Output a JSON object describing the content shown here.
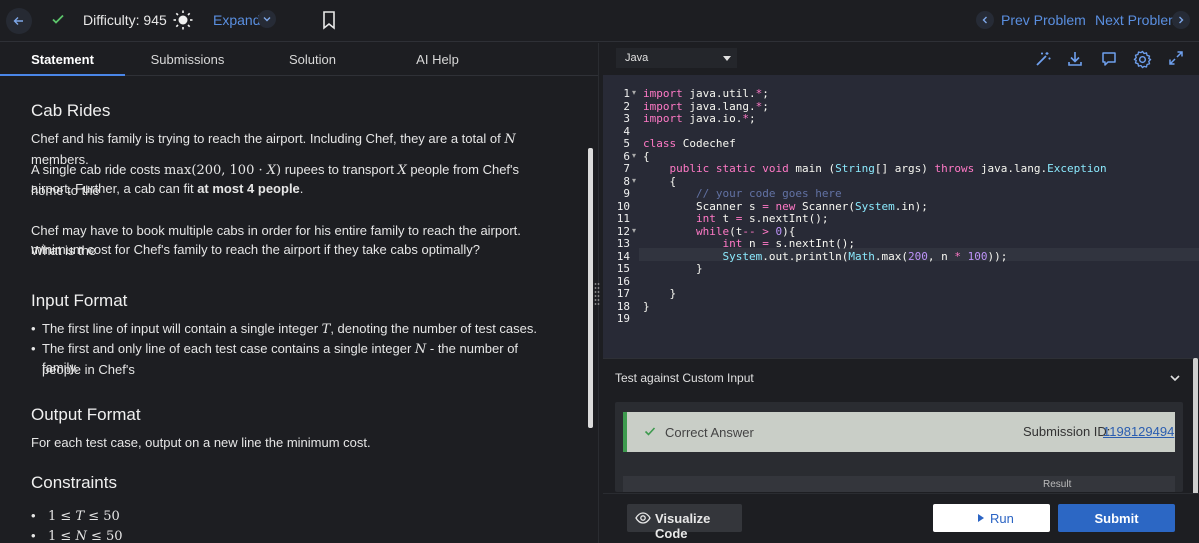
{
  "topbar": {
    "difficulty": "Difficulty: 945",
    "expand": "Expand",
    "prev": "Prev Problem",
    "next": "Next Problem"
  },
  "tabs": [
    "Statement",
    "Submissions",
    "Solution",
    "AI Help"
  ],
  "statement": {
    "title": "Cab Rides",
    "p1a": "Chef and his family is trying to reach the airport. Including Chef, they are a total of ",
    "p1var": "N",
    "p1b": " members.",
    "p2a": "A single cab ride costs ",
    "p2math1": "max(200, 100 · ",
    "p2mathvar": "X",
    "p2math2": ")",
    "p2b": " rupees to transport ",
    "p2var": "X",
    "p2c": " people from Chef's home to the",
    "p2d": "airport. Further, a cab can fit ",
    "p2bold": "at most 4 people",
    "p2e": ".",
    "p3a": "Chef may have to book multiple cabs in order for his entire family to reach the airport. What is the",
    "p3b": "minimum cost for Chef's family to reach the airport if they take cabs optimally?",
    "input_title": "Input Format",
    "in1a": "The first line of input will contain a single integer ",
    "in1var": "T",
    "in1b": ", denoting the number of test cases.",
    "in2a": "The first and only line of each test case contains a single integer ",
    "in2var": "N",
    "in2b": " - the number of people in Chef's",
    "in2c": "family.",
    "output_title": "Output Format",
    "out1": "For each test case, output on a new line the minimum cost.",
    "constraints_title": "Constraints",
    "c1a": "1 ≤ ",
    "c1var": "T",
    "c1b": " ≤ 50",
    "c2a": "1 ≤ ",
    "c2var": "N",
    "c2b": " ≤ 50"
  },
  "editor": {
    "language": "Java",
    "line_numbers": [
      "1",
      "2",
      "3",
      "4",
      "5",
      "6",
      "7",
      "8",
      "9",
      "10",
      "11",
      "12",
      "13",
      "14",
      "15",
      "16",
      "17",
      "18",
      "19"
    ]
  },
  "custom_input": "Test against Custom Input",
  "result": {
    "verdict": "Correct Answer",
    "submission_label": "Submission ID:",
    "submission_id": "1198129494",
    "result_header": "Result"
  },
  "buttons": {
    "visualize": "Visualize Code",
    "run": "Run",
    "submit": "Submit"
  },
  "colors": {
    "accent": "#2c67c4",
    "link": "#5a8fe0",
    "success": "#3d9a4e"
  }
}
